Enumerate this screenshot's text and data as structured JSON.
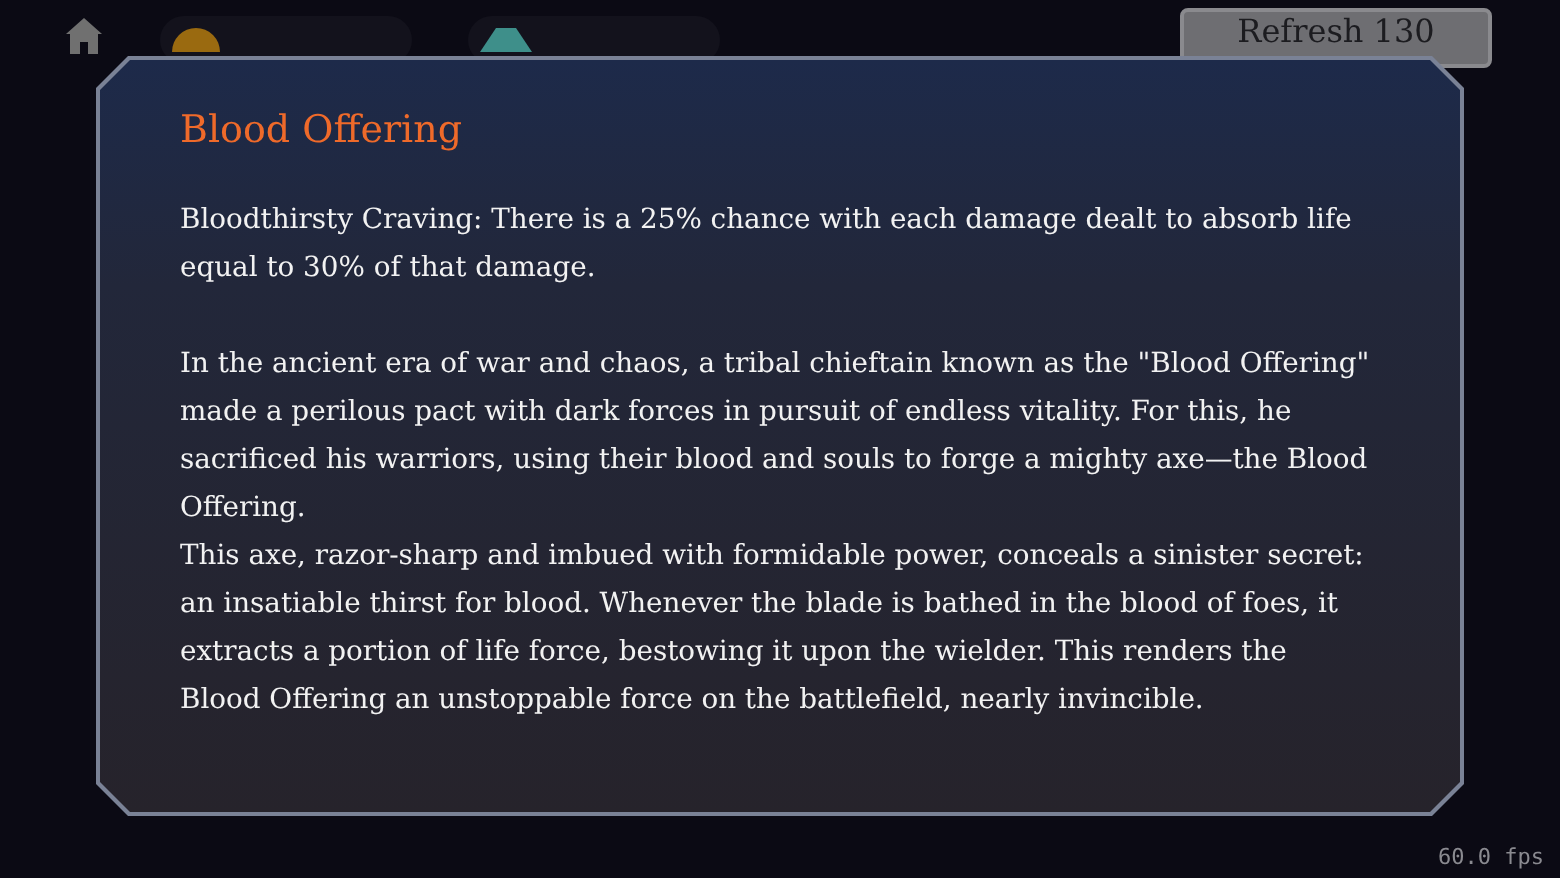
{
  "top_bar": {
    "refresh_button": "Refresh 130"
  },
  "dialog": {
    "title": "Blood Offering",
    "paragraphs": [
      "Bloodthirsty Craving: There is a 25% chance with each damage dealt to absorb life equal to 30% of that damage.",
      "In the ancient era of war and chaos, a tribal chieftain known as the \"Blood Offering\" made a perilous pact with dark forces in pursuit of endless vitality. For this, he sacrificed his warriors, using their blood and souls to forge a mighty axe—the Blood Offering.\nThis axe, razor-sharp and imbued with formidable power, conceals a sinister secret: an insatiable thirst for blood. Whenever the blade is bathed in the blood of foes, it extracts a portion of life force, bestowing it upon the wielder. This renders the Blood Offering an unstoppable force on the battlefield, nearly invincible."
    ]
  },
  "fps": "60.0 fps"
}
